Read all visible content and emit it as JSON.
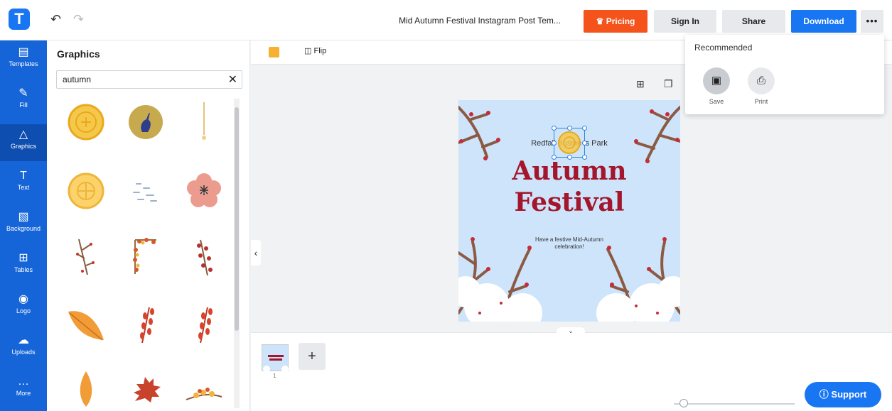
{
  "app": {
    "logo_letter": "T"
  },
  "header": {
    "doc_title": "Mid Autumn Festival Instagram Post Tem...",
    "pricing_label": "Pricing",
    "signin_label": "Sign In",
    "share_label": "Share",
    "download_label": "Download",
    "more_label": "•••"
  },
  "sidebar": {
    "items": [
      {
        "label": "Templates"
      },
      {
        "label": "Fill"
      },
      {
        "label": "Graphics"
      },
      {
        "label": "Text"
      },
      {
        "label": "Background"
      },
      {
        "label": "Tables"
      },
      {
        "label": "Logo"
      },
      {
        "label": "Uploads"
      },
      {
        "label": "More"
      }
    ]
  },
  "panel": {
    "title": "Graphics",
    "search_value": "autumn"
  },
  "toolbar": {
    "flip_label": "Flip",
    "fill_color": "#f6b133"
  },
  "design": {
    "park_text": "Redfall Busine is Park",
    "title_line1": "Autumn",
    "title_line2": "Festival",
    "subtitle": "Have a festive Mid-Autumn celebration!",
    "bg_color": "#cde4fb",
    "title_color": "#a3162b"
  },
  "pages": {
    "current": "1",
    "add_label": "+"
  },
  "dropdown": {
    "title": "Recommended",
    "items": [
      {
        "label": "Save"
      },
      {
        "label": "Print"
      }
    ]
  },
  "support": {
    "label": "Support"
  },
  "colors": {
    "accent": "#1976f2",
    "pricing": "#f4541c",
    "sidebar": "#1565d8"
  }
}
